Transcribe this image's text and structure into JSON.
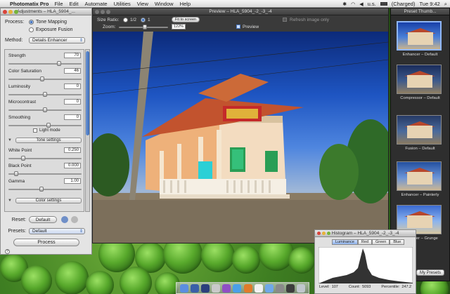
{
  "menubar": {
    "app_name": "Photomatix Pro",
    "items": [
      "File",
      "Edit",
      "Automate",
      "Utilities",
      "View",
      "Window",
      "Help"
    ],
    "status_extra": "u.s.",
    "battery": "(Charged)",
    "clock": "Tue 9:42"
  },
  "adjustments": {
    "title": "Adjustments – HLA_5904_...",
    "process_label": "Process:",
    "process_options": [
      "Tone Mapping",
      "Exposure Fusion"
    ],
    "method_label": "Method:",
    "method_value": "Details Enhancer",
    "strength_label": "Strength",
    "strength_value": "70",
    "strength_level": 70,
    "saturation_label": "Color Saturation",
    "saturation_value": "46",
    "saturation_level": 46,
    "luminosity_label": "Luminosity",
    "luminosity_value": "0",
    "luminosity_level": 50,
    "microcontrast_label": "Microcontrast",
    "microcontrast_value": "0",
    "microcontrast_level": 50,
    "smoothing_label": "Smoothing",
    "smoothing_value": "0",
    "smoothing_level": 55,
    "light_mode_label": "Light mode",
    "tone_settings_label": "Tone settings",
    "white_point_label": "White Point",
    "white_point_value": "0.250",
    "white_point_level": 18,
    "black_point_label": "Black Point",
    "black_point_value": "0.000",
    "black_point_level": 8,
    "gamma_label": "Gamma",
    "gamma_value": "1.00",
    "gamma_level": 45,
    "color_settings_label": "Color settings",
    "reset_label": "Reset:",
    "reset_value": "Default",
    "presets_label": "Presets:",
    "presets_value": "Default",
    "process_button": "Process",
    "help_glyph": "?"
  },
  "preview": {
    "title": "Preview – HLA_5904_-2_-3_-4",
    "size_ratio_label": "Size Ratio:",
    "ratio_options": [
      "1/2",
      "1"
    ],
    "fit_button": "Fit to screen",
    "refresh_label": "Refresh image only",
    "zoom_label": "Zoom:",
    "zoom_value": "122%",
    "preview_checkbox_label": "Preview"
  },
  "presets_panel": {
    "title": "Preset Thumb...",
    "thumbs": [
      {
        "label": "Enhancer – Default"
      },
      {
        "label": "Compressor – Default"
      },
      {
        "label": "Fusion – Default"
      },
      {
        "label": "Enhancer – Painterly"
      },
      {
        "label": "Enhancer – Grunge"
      }
    ],
    "my_presets_button": "My Presets"
  },
  "histogram": {
    "title": "Histogram – HLA_5904_-2_-3_-4",
    "tabs": [
      "Luminance",
      "Red",
      "Green",
      "Blue"
    ],
    "level_label": "Level:",
    "level_value": "107",
    "count_label": "Count:",
    "count_value": "5093",
    "percentile_label": "Percentile:",
    "percentile_value": "247.2"
  },
  "colors": {
    "accent": "#3a6ab8",
    "dark_panel": "#2e2e2e",
    "desktop_green": "#3f7f22"
  },
  "dock": {
    "icons": [
      "finder-icon",
      "lightroom-icon",
      "photoshop-icon",
      "preview-icon",
      "itunes-icon",
      "safari-icon",
      "firefox-icon",
      "calendar-icon",
      "mail-icon",
      "system-prefs-icon",
      "aperture-icon",
      "trash-icon"
    ]
  }
}
